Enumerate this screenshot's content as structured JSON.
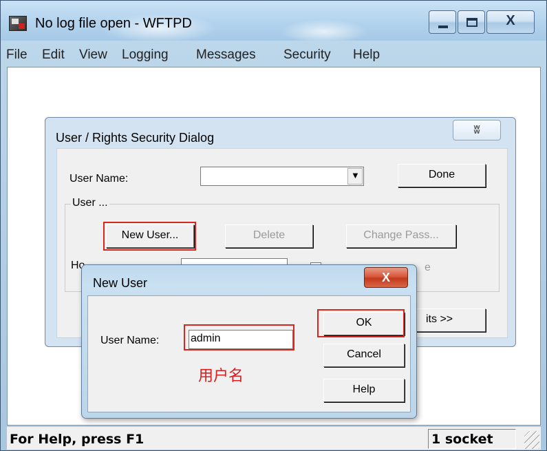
{
  "window": {
    "title": "No log file open - WFTPD",
    "controls": {
      "minimize": "minimize",
      "maximize": "maximize",
      "close": "close"
    }
  },
  "menu": [
    "File",
    "Edit",
    "View",
    "Logging",
    "Messages",
    "Security",
    "Help"
  ],
  "status": {
    "help": "For Help, press F1",
    "sockets": "1 socket"
  },
  "security_dialog": {
    "title": "User / Rights Security Dialog",
    "close_glyph": "ʬ",
    "user_name_label": "User Name:",
    "user_name_value": "",
    "done_label": "Done",
    "group_label": "User ...",
    "new_user_label": "New User...",
    "delete_label": "Delete",
    "change_pass_label": "Change Pass...",
    "home_dir_label_partial": "Ho",
    "restricted_label_partial": "e",
    "rights_label_partial": "its >>"
  },
  "new_user_dialog": {
    "title": "New User",
    "close_glyph": "X",
    "user_name_label": "User Name:",
    "user_name_value": "admin",
    "annotation": "用户名",
    "ok_label": "OK",
    "cancel_label": "Cancel",
    "help_label": "Help"
  },
  "colors": {
    "highlight": "#d9251d",
    "annotation": "#e01b1b"
  }
}
